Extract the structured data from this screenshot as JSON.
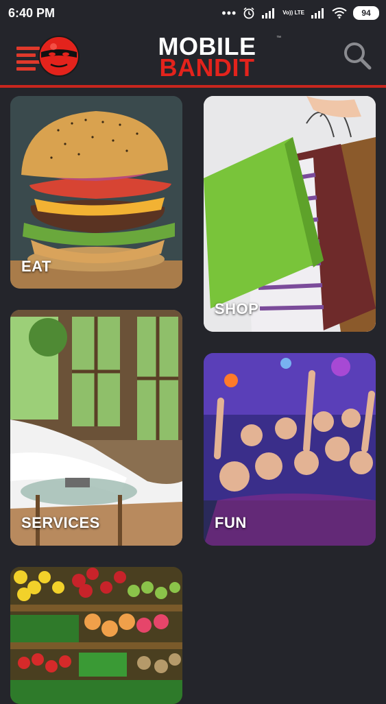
{
  "status_bar": {
    "time": "6:40 PM",
    "dots": "•••",
    "network_label": "Vo)) LTE",
    "battery": "94"
  },
  "header": {
    "logo_line1": "MOBILE",
    "logo_line2": "BANDIT",
    "trademark": "™",
    "accent_color": "#e3231c"
  },
  "tiles": [
    {
      "label": "EAT",
      "icon": "burger-image"
    },
    {
      "label": "SHOP",
      "icon": "shopping-bags-image"
    },
    {
      "label": "SERVICES",
      "icon": "spa-image"
    },
    {
      "label": "FUN",
      "icon": "party-image"
    },
    {
      "label": "",
      "icon": "produce-market-image"
    }
  ]
}
